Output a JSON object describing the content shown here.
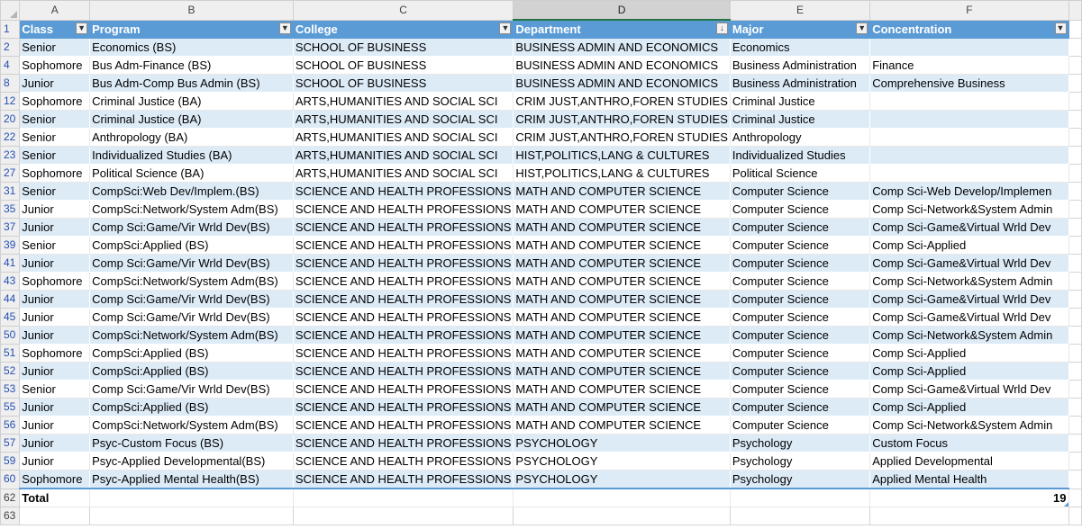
{
  "column_letters": [
    "A",
    "B",
    "C",
    "D",
    "E",
    "F"
  ],
  "selected_column": "D",
  "headers": {
    "class": "Class",
    "program": "Program",
    "college": "College",
    "department": "Department",
    "major": "Major",
    "concentration": "Concentration"
  },
  "filter_icons": {
    "class": "filter-active-icon",
    "program": "dropdown-icon",
    "college": "dropdown-icon",
    "department": "sort-filter-icon",
    "major": "dropdown-icon",
    "concentration": "dropdown-icon"
  },
  "header_row_number": "1",
  "rows": [
    {
      "row": "2",
      "class": "Senior",
      "program": "Economics (BS)",
      "college": "SCHOOL OF BUSINESS",
      "department": "BUSINESS ADMIN AND ECONOMICS",
      "major": "Economics",
      "concentration": ""
    },
    {
      "row": "4",
      "class": "Sophomore",
      "program": "Bus Adm-Finance (BS)",
      "college": "SCHOOL OF BUSINESS",
      "department": "BUSINESS ADMIN AND ECONOMICS",
      "major": "Business Administration",
      "concentration": "Finance"
    },
    {
      "row": "8",
      "class": "Junior",
      "program": "Bus Adm-Comp Bus Admin (BS)",
      "college": "SCHOOL OF BUSINESS",
      "department": "BUSINESS ADMIN AND ECONOMICS",
      "major": "Business Administration",
      "concentration": "Comprehensive Business"
    },
    {
      "row": "12",
      "class": "Sophomore",
      "program": "Criminal Justice (BA)",
      "college": "ARTS,HUMANITIES AND SOCIAL SCI",
      "department": "CRIM JUST,ANTHRO,FOREN STUDIES",
      "major": "Criminal Justice",
      "concentration": ""
    },
    {
      "row": "20",
      "class": "Senior",
      "program": "Criminal Justice (BA)",
      "college": "ARTS,HUMANITIES AND SOCIAL SCI",
      "department": "CRIM JUST,ANTHRO,FOREN STUDIES",
      "major": "Criminal Justice",
      "concentration": ""
    },
    {
      "row": "22",
      "class": "Senior",
      "program": "Anthropology (BA)",
      "college": "ARTS,HUMANITIES AND SOCIAL SCI",
      "department": "CRIM JUST,ANTHRO,FOREN STUDIES",
      "major": "Anthropology",
      "concentration": ""
    },
    {
      "row": "23",
      "class": "Senior",
      "program": "Individualized Studies (BA)",
      "college": "ARTS,HUMANITIES AND SOCIAL SCI",
      "department": "HIST,POLITICS,LANG & CULTURES",
      "major": "Individualized Studies",
      "concentration": ""
    },
    {
      "row": "27",
      "class": "Sophomore",
      "program": "Political Science (BA)",
      "college": "ARTS,HUMANITIES AND SOCIAL SCI",
      "department": "HIST,POLITICS,LANG & CULTURES",
      "major": "Political Science",
      "concentration": ""
    },
    {
      "row": "31",
      "class": "Senior",
      "program": "CompSci:Web Dev/Implem.(BS)",
      "college": "SCIENCE AND HEALTH PROFESSIONS",
      "department": "MATH AND COMPUTER SCIENCE",
      "major": "Computer Science",
      "concentration": "Comp Sci-Web Develop/Implemen"
    },
    {
      "row": "35",
      "class": "Junior",
      "program": "CompSci:Network/System Adm(BS)",
      "college": "SCIENCE AND HEALTH PROFESSIONS",
      "department": "MATH AND COMPUTER SCIENCE",
      "major": "Computer Science",
      "concentration": "Comp Sci-Network&System Admin"
    },
    {
      "row": "37",
      "class": "Junior",
      "program": "Comp Sci:Game/Vir Wrld Dev(BS)",
      "college": "SCIENCE AND HEALTH PROFESSIONS",
      "department": "MATH AND COMPUTER SCIENCE",
      "major": "Computer Science",
      "concentration": "Comp Sci-Game&Virtual Wrld Dev"
    },
    {
      "row": "39",
      "class": "Senior",
      "program": "CompSci:Applied (BS)",
      "college": "SCIENCE AND HEALTH PROFESSIONS",
      "department": "MATH AND COMPUTER SCIENCE",
      "major": "Computer Science",
      "concentration": "Comp Sci-Applied"
    },
    {
      "row": "41",
      "class": "Junior",
      "program": "Comp Sci:Game/Vir Wrld Dev(BS)",
      "college": "SCIENCE AND HEALTH PROFESSIONS",
      "department": "MATH AND COMPUTER SCIENCE",
      "major": "Computer Science",
      "concentration": "Comp Sci-Game&Virtual Wrld Dev"
    },
    {
      "row": "43",
      "class": "Sophomore",
      "program": "CompSci:Network/System Adm(BS)",
      "college": "SCIENCE AND HEALTH PROFESSIONS",
      "department": "MATH AND COMPUTER SCIENCE",
      "major": "Computer Science",
      "concentration": "Comp Sci-Network&System Admin"
    },
    {
      "row": "44",
      "class": "Junior",
      "program": "Comp Sci:Game/Vir Wrld Dev(BS)",
      "college": "SCIENCE AND HEALTH PROFESSIONS",
      "department": "MATH AND COMPUTER SCIENCE",
      "major": "Computer Science",
      "concentration": "Comp Sci-Game&Virtual Wrld Dev"
    },
    {
      "row": "45",
      "class": "Junior",
      "program": "Comp Sci:Game/Vir Wrld Dev(BS)",
      "college": "SCIENCE AND HEALTH PROFESSIONS",
      "department": "MATH AND COMPUTER SCIENCE",
      "major": "Computer Science",
      "concentration": "Comp Sci-Game&Virtual Wrld Dev"
    },
    {
      "row": "50",
      "class": "Junior",
      "program": "CompSci:Network/System Adm(BS)",
      "college": "SCIENCE AND HEALTH PROFESSIONS",
      "department": "MATH AND COMPUTER SCIENCE",
      "major": "Computer Science",
      "concentration": "Comp Sci-Network&System Admin"
    },
    {
      "row": "51",
      "class": "Sophomore",
      "program": "CompSci:Applied (BS)",
      "college": "SCIENCE AND HEALTH PROFESSIONS",
      "department": "MATH AND COMPUTER SCIENCE",
      "major": "Computer Science",
      "concentration": "Comp Sci-Applied"
    },
    {
      "row": "52",
      "class": "Junior",
      "program": "CompSci:Applied (BS)",
      "college": "SCIENCE AND HEALTH PROFESSIONS",
      "department": "MATH AND COMPUTER SCIENCE",
      "major": "Computer Science",
      "concentration": "Comp Sci-Applied"
    },
    {
      "row": "53",
      "class": "Senior",
      "program": "Comp Sci:Game/Vir Wrld Dev(BS)",
      "college": "SCIENCE AND HEALTH PROFESSIONS",
      "department": "MATH AND COMPUTER SCIENCE",
      "major": "Computer Science",
      "concentration": "Comp Sci-Game&Virtual Wrld Dev"
    },
    {
      "row": "55",
      "class": "Junior",
      "program": "CompSci:Applied (BS)",
      "college": "SCIENCE AND HEALTH PROFESSIONS",
      "department": "MATH AND COMPUTER SCIENCE",
      "major": "Computer Science",
      "concentration": "Comp Sci-Applied"
    },
    {
      "row": "56",
      "class": "Junior",
      "program": "CompSci:Network/System Adm(BS)",
      "college": "SCIENCE AND HEALTH PROFESSIONS",
      "department": "MATH AND COMPUTER SCIENCE",
      "major": "Computer Science",
      "concentration": "Comp Sci-Network&System Admin"
    },
    {
      "row": "57",
      "class": "Junior",
      "program": "Psyc-Custom Focus (BS)",
      "college": "SCIENCE AND HEALTH PROFESSIONS",
      "department": "PSYCHOLOGY",
      "major": "Psychology",
      "concentration": "Custom Focus"
    },
    {
      "row": "59",
      "class": "Junior",
      "program": "Psyc-Applied Developmental(BS)",
      "college": "SCIENCE AND HEALTH PROFESSIONS",
      "department": "PSYCHOLOGY",
      "major": "Psychology",
      "concentration": "Applied Developmental"
    },
    {
      "row": "60",
      "class": "Sophomore",
      "program": "Psyc-Applied Mental Health(BS)",
      "college": "SCIENCE AND HEALTH PROFESSIONS",
      "department": "PSYCHOLOGY",
      "major": "Psychology",
      "concentration": "Applied Mental Health"
    }
  ],
  "total_row": {
    "row": "62",
    "label": "Total",
    "count": "19"
  },
  "trailing_rows": [
    "63"
  ],
  "colors": {
    "header_fill": "#5b9bd5",
    "band_fill": "#ddebf7",
    "row_link": "#2450b3",
    "selected_col_underline": "#217346"
  }
}
